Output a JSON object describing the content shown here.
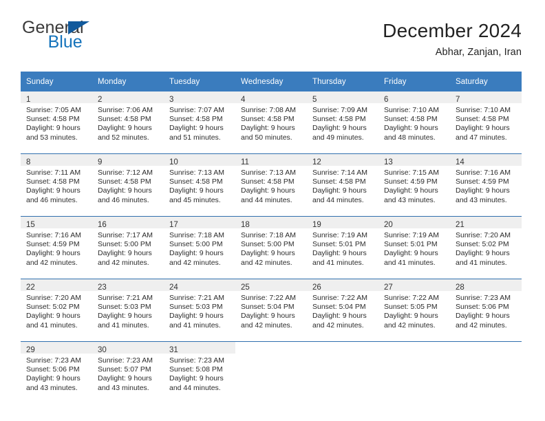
{
  "brand": {
    "name_part1": "General",
    "name_part2": "Blue"
  },
  "header": {
    "title": "December 2024",
    "location": "Abhar, Zanjan, Iran"
  },
  "colors": {
    "header_blue": "#3a7cbe",
    "row_divider_blue": "#2f6fae",
    "daynum_band": "#efefef",
    "logo_blue": "#1573bb",
    "logo_flag": "#125a9c"
  },
  "weekday_headers": [
    "Sunday",
    "Monday",
    "Tuesday",
    "Wednesday",
    "Thursday",
    "Friday",
    "Saturday"
  ],
  "weeks": [
    [
      {
        "day": "1",
        "sunrise": "Sunrise: 7:05 AM",
        "sunset": "Sunset: 4:58 PM",
        "daylight1": "Daylight: 9 hours",
        "daylight2": "and 53 minutes."
      },
      {
        "day": "2",
        "sunrise": "Sunrise: 7:06 AM",
        "sunset": "Sunset: 4:58 PM",
        "daylight1": "Daylight: 9 hours",
        "daylight2": "and 52 minutes."
      },
      {
        "day": "3",
        "sunrise": "Sunrise: 7:07 AM",
        "sunset": "Sunset: 4:58 PM",
        "daylight1": "Daylight: 9 hours",
        "daylight2": "and 51 minutes."
      },
      {
        "day": "4",
        "sunrise": "Sunrise: 7:08 AM",
        "sunset": "Sunset: 4:58 PM",
        "daylight1": "Daylight: 9 hours",
        "daylight2": "and 50 minutes."
      },
      {
        "day": "5",
        "sunrise": "Sunrise: 7:09 AM",
        "sunset": "Sunset: 4:58 PM",
        "daylight1": "Daylight: 9 hours",
        "daylight2": "and 49 minutes."
      },
      {
        "day": "6",
        "sunrise": "Sunrise: 7:10 AM",
        "sunset": "Sunset: 4:58 PM",
        "daylight1": "Daylight: 9 hours",
        "daylight2": "and 48 minutes."
      },
      {
        "day": "7",
        "sunrise": "Sunrise: 7:10 AM",
        "sunset": "Sunset: 4:58 PM",
        "daylight1": "Daylight: 9 hours",
        "daylight2": "and 47 minutes."
      }
    ],
    [
      {
        "day": "8",
        "sunrise": "Sunrise: 7:11 AM",
        "sunset": "Sunset: 4:58 PM",
        "daylight1": "Daylight: 9 hours",
        "daylight2": "and 46 minutes."
      },
      {
        "day": "9",
        "sunrise": "Sunrise: 7:12 AM",
        "sunset": "Sunset: 4:58 PM",
        "daylight1": "Daylight: 9 hours",
        "daylight2": "and 46 minutes."
      },
      {
        "day": "10",
        "sunrise": "Sunrise: 7:13 AM",
        "sunset": "Sunset: 4:58 PM",
        "daylight1": "Daylight: 9 hours",
        "daylight2": "and 45 minutes."
      },
      {
        "day": "11",
        "sunrise": "Sunrise: 7:13 AM",
        "sunset": "Sunset: 4:58 PM",
        "daylight1": "Daylight: 9 hours",
        "daylight2": "and 44 minutes."
      },
      {
        "day": "12",
        "sunrise": "Sunrise: 7:14 AM",
        "sunset": "Sunset: 4:58 PM",
        "daylight1": "Daylight: 9 hours",
        "daylight2": "and 44 minutes."
      },
      {
        "day": "13",
        "sunrise": "Sunrise: 7:15 AM",
        "sunset": "Sunset: 4:59 PM",
        "daylight1": "Daylight: 9 hours",
        "daylight2": "and 43 minutes."
      },
      {
        "day": "14",
        "sunrise": "Sunrise: 7:16 AM",
        "sunset": "Sunset: 4:59 PM",
        "daylight1": "Daylight: 9 hours",
        "daylight2": "and 43 minutes."
      }
    ],
    [
      {
        "day": "15",
        "sunrise": "Sunrise: 7:16 AM",
        "sunset": "Sunset: 4:59 PM",
        "daylight1": "Daylight: 9 hours",
        "daylight2": "and 42 minutes."
      },
      {
        "day": "16",
        "sunrise": "Sunrise: 7:17 AM",
        "sunset": "Sunset: 5:00 PM",
        "daylight1": "Daylight: 9 hours",
        "daylight2": "and 42 minutes."
      },
      {
        "day": "17",
        "sunrise": "Sunrise: 7:18 AM",
        "sunset": "Sunset: 5:00 PM",
        "daylight1": "Daylight: 9 hours",
        "daylight2": "and 42 minutes."
      },
      {
        "day": "18",
        "sunrise": "Sunrise: 7:18 AM",
        "sunset": "Sunset: 5:00 PM",
        "daylight1": "Daylight: 9 hours",
        "daylight2": "and 42 minutes."
      },
      {
        "day": "19",
        "sunrise": "Sunrise: 7:19 AM",
        "sunset": "Sunset: 5:01 PM",
        "daylight1": "Daylight: 9 hours",
        "daylight2": "and 41 minutes."
      },
      {
        "day": "20",
        "sunrise": "Sunrise: 7:19 AM",
        "sunset": "Sunset: 5:01 PM",
        "daylight1": "Daylight: 9 hours",
        "daylight2": "and 41 minutes."
      },
      {
        "day": "21",
        "sunrise": "Sunrise: 7:20 AM",
        "sunset": "Sunset: 5:02 PM",
        "daylight1": "Daylight: 9 hours",
        "daylight2": "and 41 minutes."
      }
    ],
    [
      {
        "day": "22",
        "sunrise": "Sunrise: 7:20 AM",
        "sunset": "Sunset: 5:02 PM",
        "daylight1": "Daylight: 9 hours",
        "daylight2": "and 41 minutes."
      },
      {
        "day": "23",
        "sunrise": "Sunrise: 7:21 AM",
        "sunset": "Sunset: 5:03 PM",
        "daylight1": "Daylight: 9 hours",
        "daylight2": "and 41 minutes."
      },
      {
        "day": "24",
        "sunrise": "Sunrise: 7:21 AM",
        "sunset": "Sunset: 5:03 PM",
        "daylight1": "Daylight: 9 hours",
        "daylight2": "and 41 minutes."
      },
      {
        "day": "25",
        "sunrise": "Sunrise: 7:22 AM",
        "sunset": "Sunset: 5:04 PM",
        "daylight1": "Daylight: 9 hours",
        "daylight2": "and 42 minutes."
      },
      {
        "day": "26",
        "sunrise": "Sunrise: 7:22 AM",
        "sunset": "Sunset: 5:04 PM",
        "daylight1": "Daylight: 9 hours",
        "daylight2": "and 42 minutes."
      },
      {
        "day": "27",
        "sunrise": "Sunrise: 7:22 AM",
        "sunset": "Sunset: 5:05 PM",
        "daylight1": "Daylight: 9 hours",
        "daylight2": "and 42 minutes."
      },
      {
        "day": "28",
        "sunrise": "Sunrise: 7:23 AM",
        "sunset": "Sunset: 5:06 PM",
        "daylight1": "Daylight: 9 hours",
        "daylight2": "and 42 minutes."
      }
    ],
    [
      {
        "day": "29",
        "sunrise": "Sunrise: 7:23 AM",
        "sunset": "Sunset: 5:06 PM",
        "daylight1": "Daylight: 9 hours",
        "daylight2": "and 43 minutes."
      },
      {
        "day": "30",
        "sunrise": "Sunrise: 7:23 AM",
        "sunset": "Sunset: 5:07 PM",
        "daylight1": "Daylight: 9 hours",
        "daylight2": "and 43 minutes."
      },
      {
        "day": "31",
        "sunrise": "Sunrise: 7:23 AM",
        "sunset": "Sunset: 5:08 PM",
        "daylight1": "Daylight: 9 hours",
        "daylight2": "and 44 minutes."
      },
      {
        "day": "",
        "sunrise": "",
        "sunset": "",
        "daylight1": "",
        "daylight2": ""
      },
      {
        "day": "",
        "sunrise": "",
        "sunset": "",
        "daylight1": "",
        "daylight2": ""
      },
      {
        "day": "",
        "sunrise": "",
        "sunset": "",
        "daylight1": "",
        "daylight2": ""
      },
      {
        "day": "",
        "sunrise": "",
        "sunset": "",
        "daylight1": "",
        "daylight2": ""
      }
    ]
  ]
}
